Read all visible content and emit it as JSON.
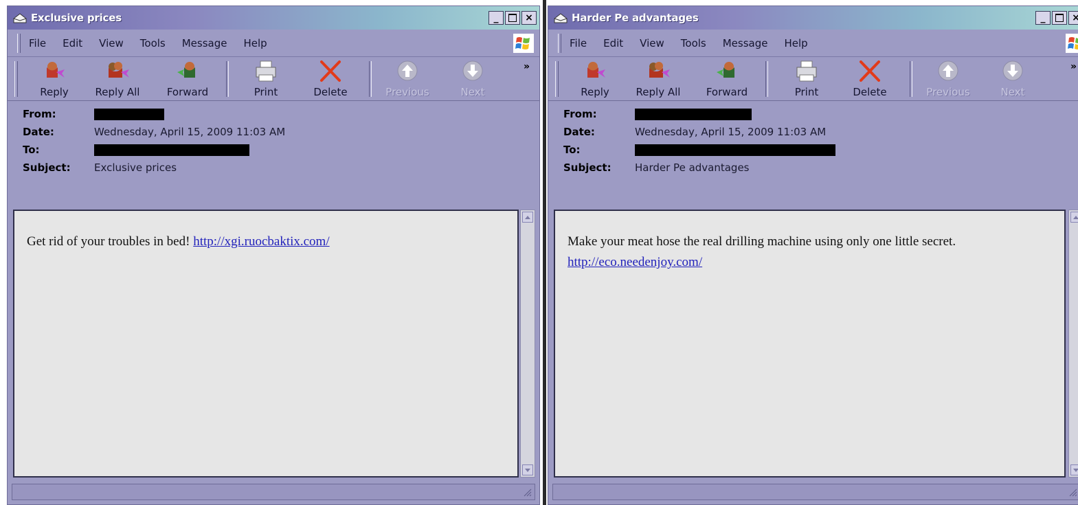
{
  "windows": [
    {
      "title": "Exclusive prices",
      "menu": [
        "File",
        "Edit",
        "View",
        "Tools",
        "Message",
        "Help"
      ],
      "toolbar": {
        "reply": "Reply",
        "reply_all": "Reply All",
        "forward": "Forward",
        "print": "Print",
        "delete": "Delete",
        "previous": "Previous",
        "next": "Next"
      },
      "header": {
        "from_label": "From:",
        "date_label": "Date:",
        "to_label": "To:",
        "subject_label": "Subject:",
        "date": "Wednesday, April 15, 2009 11:03 AM",
        "subject": "Exclusive prices"
      },
      "body": {
        "text": "Get rid of your troubles in bed! ",
        "link": "http://xgi.ruocbaktix.com/"
      }
    },
    {
      "title": "Harder Pe advantages",
      "menu": [
        "File",
        "Edit",
        "View",
        "Tools",
        "Message",
        "Help"
      ],
      "toolbar": {
        "reply": "Reply",
        "reply_all": "Reply All",
        "forward": "Forward",
        "print": "Print",
        "delete": "Delete",
        "previous": "Previous",
        "next": "Next"
      },
      "header": {
        "from_label": "From:",
        "date_label": "Date:",
        "to_label": "To:",
        "subject_label": "Subject:",
        "date": "Wednesday, April 15, 2009 11:03 AM",
        "subject": "Harder Pe advantages"
      },
      "body": {
        "text": "Make your meat hose the real drilling machine using only one little secret.",
        "link": "http://eco.needenjoy.com/"
      }
    }
  ],
  "icons": {
    "title": "mail-envelope-icon",
    "reply": "reply-icon",
    "reply_all": "reply-all-icon",
    "forward": "forward-icon",
    "print": "printer-icon",
    "delete": "delete-x-icon",
    "previous": "up-arrow-icon",
    "next": "down-arrow-icon",
    "logo": "windows-logo-icon"
  },
  "colors": {
    "window_bg": "#9d9bc4",
    "link": "#2222bb",
    "delete_red": "#e23a1a"
  }
}
